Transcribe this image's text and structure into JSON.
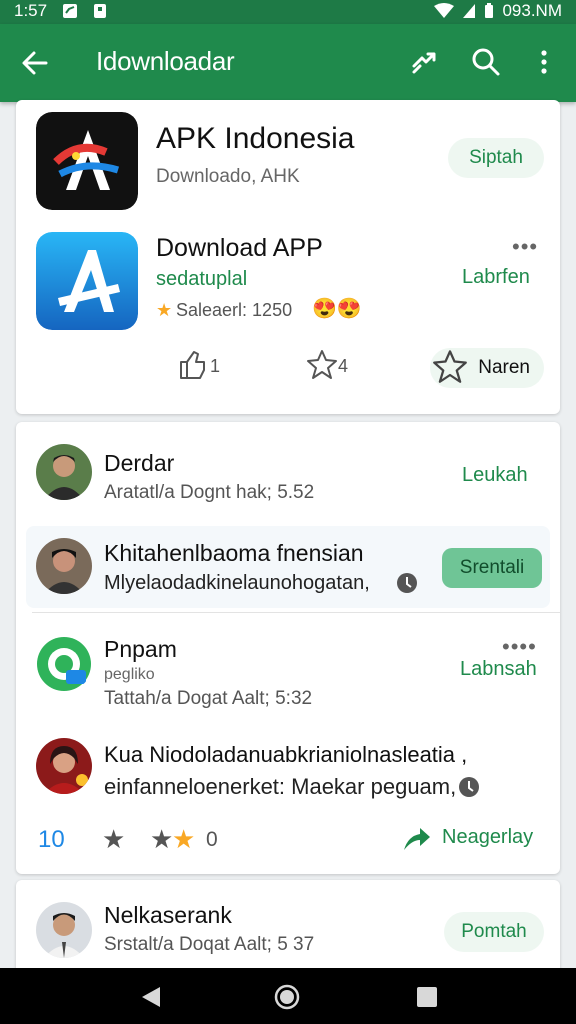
{
  "status": {
    "time": "1:57",
    "right": "093.NM"
  },
  "appbar": {
    "title": "Idownloadar"
  },
  "apps": [
    {
      "name": "APK Indonesia",
      "sub": "Downloado, AHK",
      "action": "Siptah"
    },
    {
      "name": "Download APP",
      "dev": "sedatuplal",
      "rating": "Saleaerl: 1250",
      "action": "Labrfen"
    }
  ],
  "app_actions": {
    "like_count": "1",
    "star_count": "4",
    "rate_label": "Naren"
  },
  "feed": {
    "u1": {
      "name": "Derdar",
      "meta": "Aratatl/a Dognt hak; 5.52",
      "action": "Leukah"
    },
    "u2": {
      "name": "Khitahenlbaoma fnensian",
      "meta": "Mlyelaodadkinelaunohogatan,",
      "action": "Srentali"
    },
    "u3": {
      "name": "Pnpam",
      "sub": "pegliko",
      "meta": "Tattah/a Dogat Aalt; 5:32",
      "action": "Labnsah"
    },
    "u4": {
      "line1": "Kua Niodoladanuabkrianiolnasleatia ,",
      "line2": "einfanneloenerket: Maekar peguam,"
    },
    "bottom": {
      "count": "10",
      "zero": "0",
      "share": "Neagerlay"
    }
  },
  "u5": {
    "name": "Nelkaserank",
    "meta": "Srstalt/a Doqat Aalt; 5 37",
    "action": "Pomtah"
  },
  "colors": {
    "primary": "#1f8a4c",
    "status": "#1e7a46",
    "pill": "#eef7f1"
  }
}
